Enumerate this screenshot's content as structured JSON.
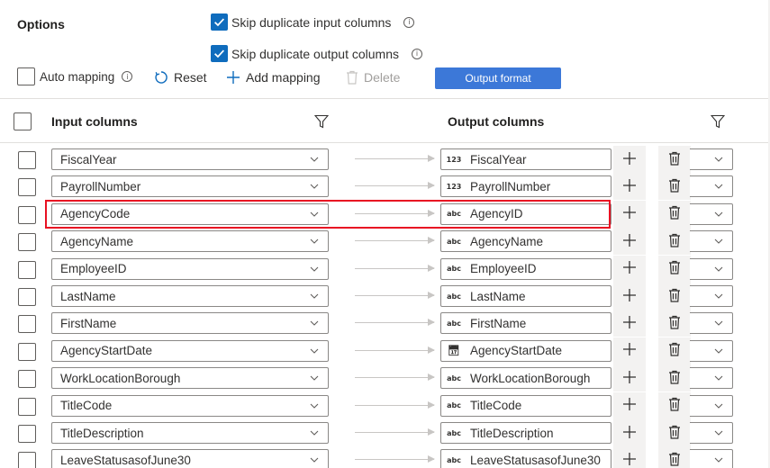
{
  "options": {
    "title": "Options",
    "skip_input_label": "Skip duplicate input columns",
    "skip_output_label": "Skip duplicate output columns",
    "skip_input_checked": true,
    "skip_output_checked": true
  },
  "toolbar": {
    "auto_mapping_label": "Auto mapping",
    "reset_label": "Reset",
    "add_mapping_label": "Add mapping",
    "delete_label": "Delete",
    "output_format_label": "Output format"
  },
  "headers": {
    "input": "Input columns",
    "output": "Output columns"
  },
  "rows": [
    {
      "input": "FiscalYear",
      "type": "123",
      "output": "FiscalYear"
    },
    {
      "input": "PayrollNumber",
      "type": "123",
      "output": "PayrollNumber"
    },
    {
      "input": "AgencyCode",
      "type": "abc",
      "output": "AgencyID"
    },
    {
      "input": "AgencyName",
      "type": "abc",
      "output": "AgencyName"
    },
    {
      "input": "EmployeeID",
      "type": "abc",
      "output": "EmployeeID"
    },
    {
      "input": "LastName",
      "type": "abc",
      "output": "LastName"
    },
    {
      "input": "FirstName",
      "type": "abc",
      "output": "FirstName"
    },
    {
      "input": "AgencyStartDate",
      "type": "calendar",
      "output": "AgencyStartDate"
    },
    {
      "input": "WorkLocationBorough",
      "type": "abc",
      "output": "WorkLocationBorough"
    },
    {
      "input": "TitleCode",
      "type": "abc",
      "output": "TitleCode"
    },
    {
      "input": "TitleDescription",
      "type": "abc",
      "output": "TitleDescription"
    },
    {
      "input": "LeaveStatusasofJune30",
      "type": "abc",
      "output": "LeaveStatusasofJune30"
    }
  ],
  "highlighted_row": "AgencyCode",
  "colors": {
    "accent": "#0f6cbd",
    "button": "#3c78d8",
    "highlight": "#e81123"
  }
}
